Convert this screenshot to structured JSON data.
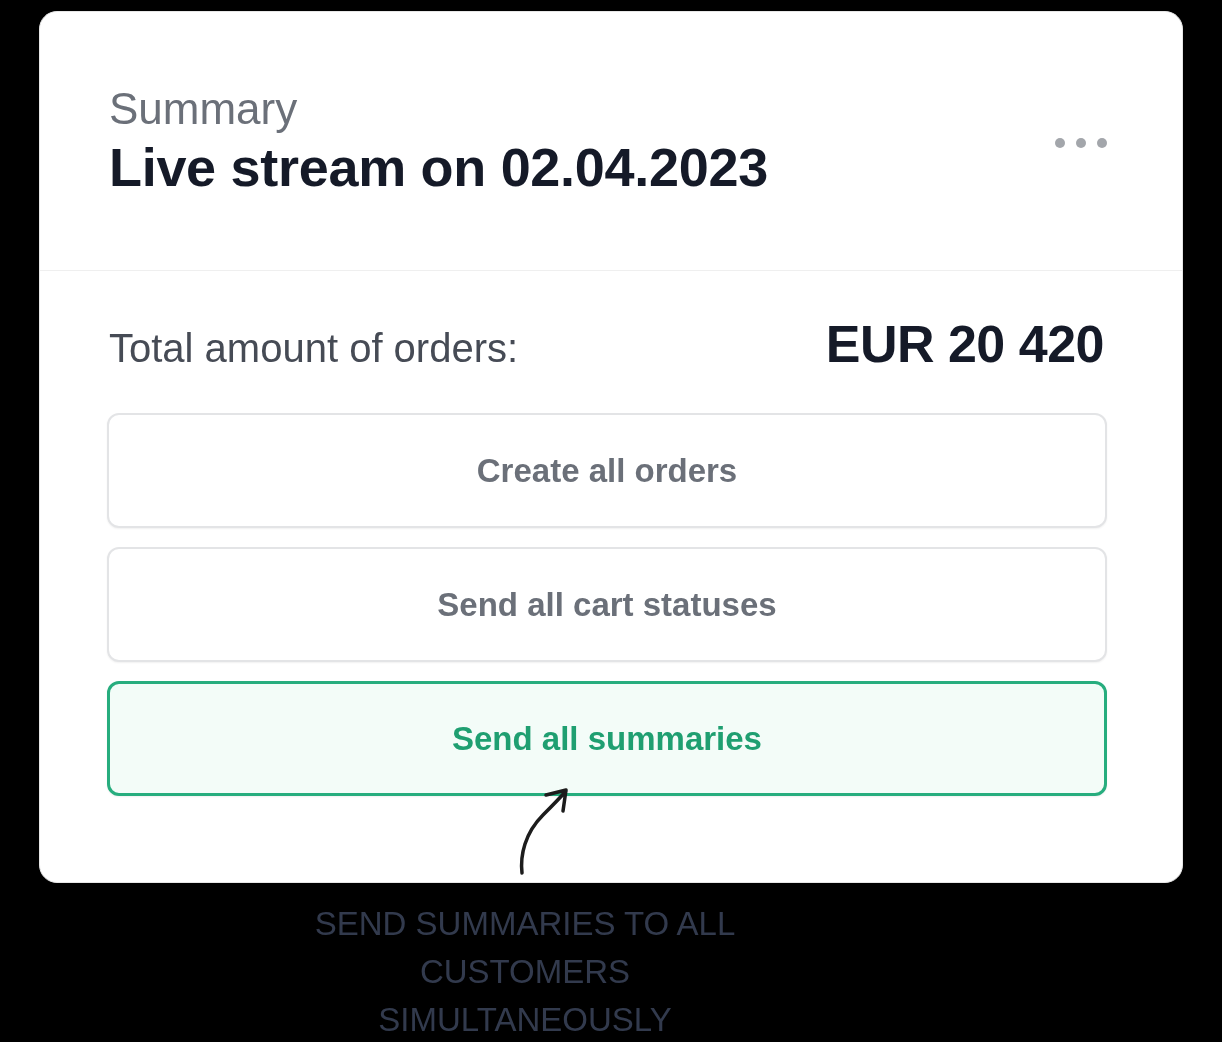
{
  "card": {
    "header": {
      "eyebrow": "Summary",
      "title": "Live stream on 02.04.2023"
    },
    "total": {
      "label": "Total amount of orders:",
      "value": "EUR 20 420"
    },
    "buttons": [
      {
        "label": "Create all orders",
        "highlighted": false
      },
      {
        "label": "Send all cart statuses",
        "highlighted": false
      },
      {
        "label": "Send all summaries",
        "highlighted": true
      }
    ]
  },
  "annotation": {
    "text": "SEND SUMMARIES TO ALL CUSTOMERS SIMULTANEOUSLY"
  }
}
